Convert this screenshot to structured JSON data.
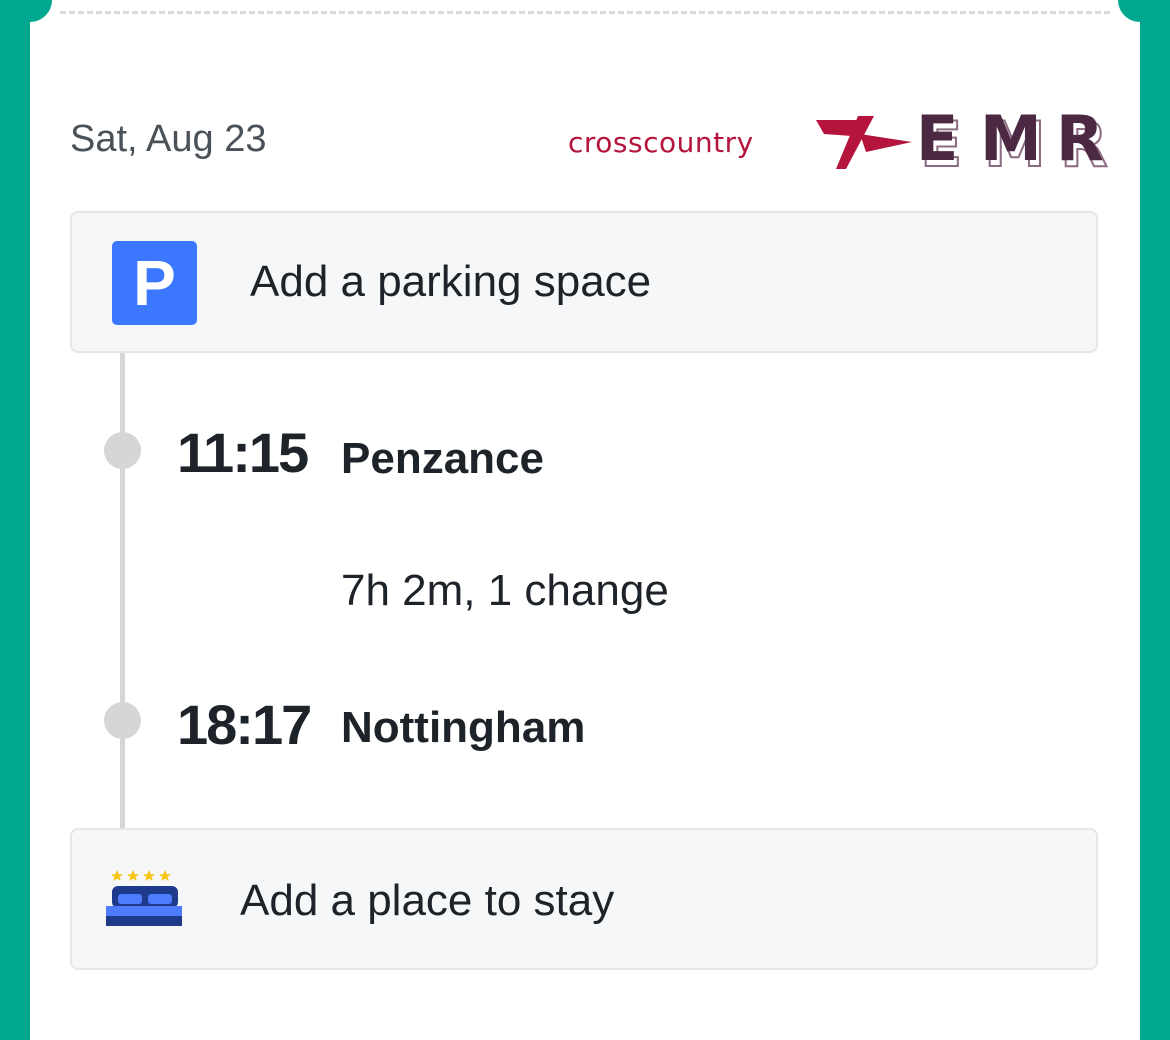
{
  "journey": {
    "date": "Sat, Aug 23",
    "operators": [
      {
        "name": "crosscountry",
        "color": "#b5143d"
      },
      {
        "name": "EMR",
        "letters": [
          "E",
          "M",
          "R"
        ],
        "color": "#4b2942"
      }
    ],
    "parking_label": "Add a parking space",
    "parking_icon_letter": "P",
    "departure": {
      "time": "11:15",
      "station": "Penzance"
    },
    "duration": "7h 2m, 1 change",
    "arrival": {
      "time": "18:17",
      "station": "Nottingham"
    },
    "stay_label": "Add a place to stay"
  },
  "colors": {
    "background": "#00a88f",
    "parking_icon": "#3b78ff",
    "bed_icon": "#1e3a8a",
    "stars": "#f5c518"
  },
  "icons": {
    "parking": "parking-icon",
    "bed": "hotel-bed-icon",
    "crosscountry_mark": "crosscountry-logo-icon"
  }
}
